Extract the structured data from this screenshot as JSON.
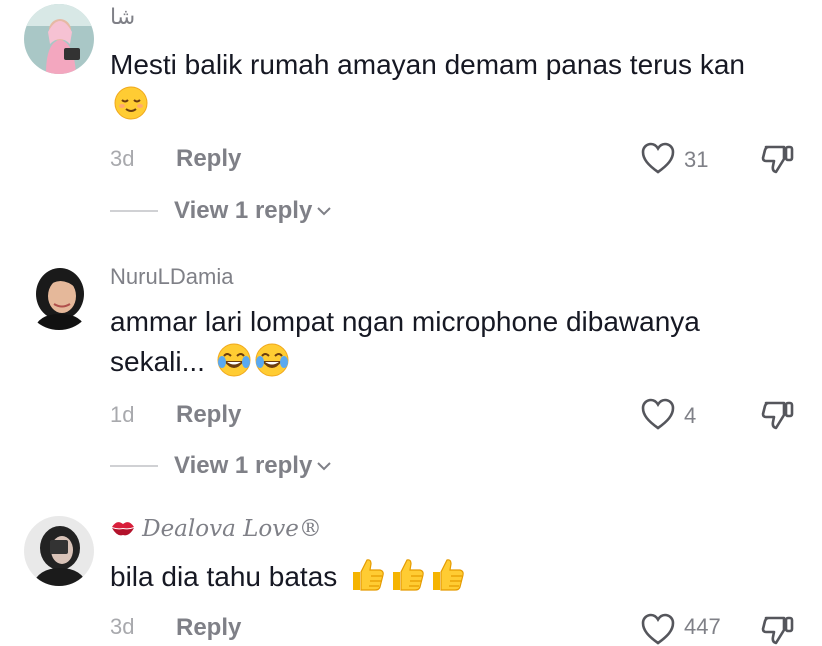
{
  "comments": [
    {
      "username": "شا",
      "text": "Mesti balik rumah amayan demam panas terus kan",
      "emojis": [
        "relieved-face-emoji"
      ],
      "date": "3d",
      "reply_label": "Reply",
      "likes": "31",
      "view_replies": "View 1 reply"
    },
    {
      "username": "NuruLDamia",
      "text": "ammar lari lompat ngan microphone dibawanya sekali...",
      "emojis": [
        "tears-of-joy-emoji",
        "tears-of-joy-emoji"
      ],
      "date": "1d",
      "reply_label": "Reply",
      "likes": "4",
      "view_replies": "View 1 reply"
    },
    {
      "username": "Dealova Love®",
      "username_prefix_icon": "kiss-mark-emoji",
      "text": "bila dia tahu batas",
      "emojis": [
        "thumbs-up-emoji",
        "thumbs-up-emoji",
        "thumbs-up-emoji"
      ],
      "date": "3d",
      "reply_label": "Reply",
      "likes": "447"
    }
  ],
  "colors": {
    "primary_text": "#161823",
    "secondary_text": "#7f8087",
    "tertiary_text": "#a8a9ad",
    "emoji_yellow": "#ffcc33"
  }
}
